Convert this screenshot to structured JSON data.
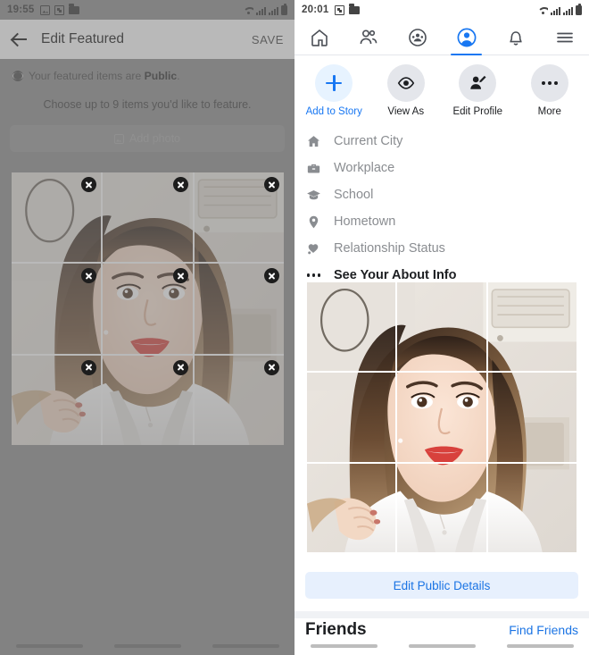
{
  "left_panel": {
    "status_bar": {
      "time": "19:55",
      "left_icons": [
        "gallery-icon",
        "qr-icon",
        "folder-icon"
      ],
      "right_icons": [
        "wifi-icon",
        "signal-icon",
        "signal-icon",
        "battery-icon"
      ]
    },
    "header": {
      "back_icon": "back-arrow-icon",
      "title": "Edit Featured",
      "save_label": "SAVE"
    },
    "privacy_notice": {
      "icon": "globe-icon",
      "prefix": "Your featured items are ",
      "value": "Public",
      "suffix": "."
    },
    "instruction": "Choose up to 9 items you'd like to feature.",
    "add_photo": {
      "icon": "photo-icon",
      "label": "Add photo"
    },
    "grid": {
      "remove_label": "x",
      "cells": 9
    },
    "nav_pills": 3
  },
  "right_panel": {
    "status_bar": {
      "time": "20:01",
      "left_icons": [
        "qr-icon",
        "folder-icon"
      ],
      "right_icons": [
        "wifi-icon",
        "signal-icon",
        "signal-icon",
        "battery-icon"
      ]
    },
    "nav_tabs": [
      {
        "name": "home",
        "icon": "home-icon",
        "active": false
      },
      {
        "name": "friends",
        "icon": "friends-icon",
        "active": false
      },
      {
        "name": "groups",
        "icon": "groups-icon",
        "active": false
      },
      {
        "name": "profile",
        "icon": "profile-avatar-icon",
        "active": true
      },
      {
        "name": "notifications",
        "icon": "bell-icon",
        "active": false
      },
      {
        "name": "menu",
        "icon": "hamburger-menu-icon",
        "active": false
      }
    ],
    "actions": [
      {
        "label": "Add to Story",
        "icon": "plus-icon"
      },
      {
        "label": "View As",
        "icon": "eye-icon"
      },
      {
        "label": "Edit Profile",
        "icon": "edit-profile-icon"
      },
      {
        "label": "More",
        "icon": "more-dots-icon"
      }
    ],
    "info_rows": [
      {
        "label": "Current City",
        "icon": "home-filled-icon"
      },
      {
        "label": "Workplace",
        "icon": "briefcase-icon"
      },
      {
        "label": "School",
        "icon": "graduation-cap-icon"
      },
      {
        "label": "Hometown",
        "icon": "location-pin-icon"
      },
      {
        "label": "Relationship Status",
        "icon": "heart-icon"
      },
      {
        "label": "See Your About Info",
        "icon": "more-dots-icon"
      }
    ],
    "edit_public_details": "Edit Public Details",
    "friends_heading": "Friends",
    "find_friends": "Find Friends",
    "nav_pills": 3
  },
  "colors": {
    "facebook_blue": "#1877f2",
    "link_blue": "#1b74e4",
    "story_bg": "#e7f3ff",
    "action_bg": "#e4e6eb",
    "muted_text": "#8a8d91",
    "dim_overlay": "#787878",
    "left_bg": "#8c8c8c"
  }
}
